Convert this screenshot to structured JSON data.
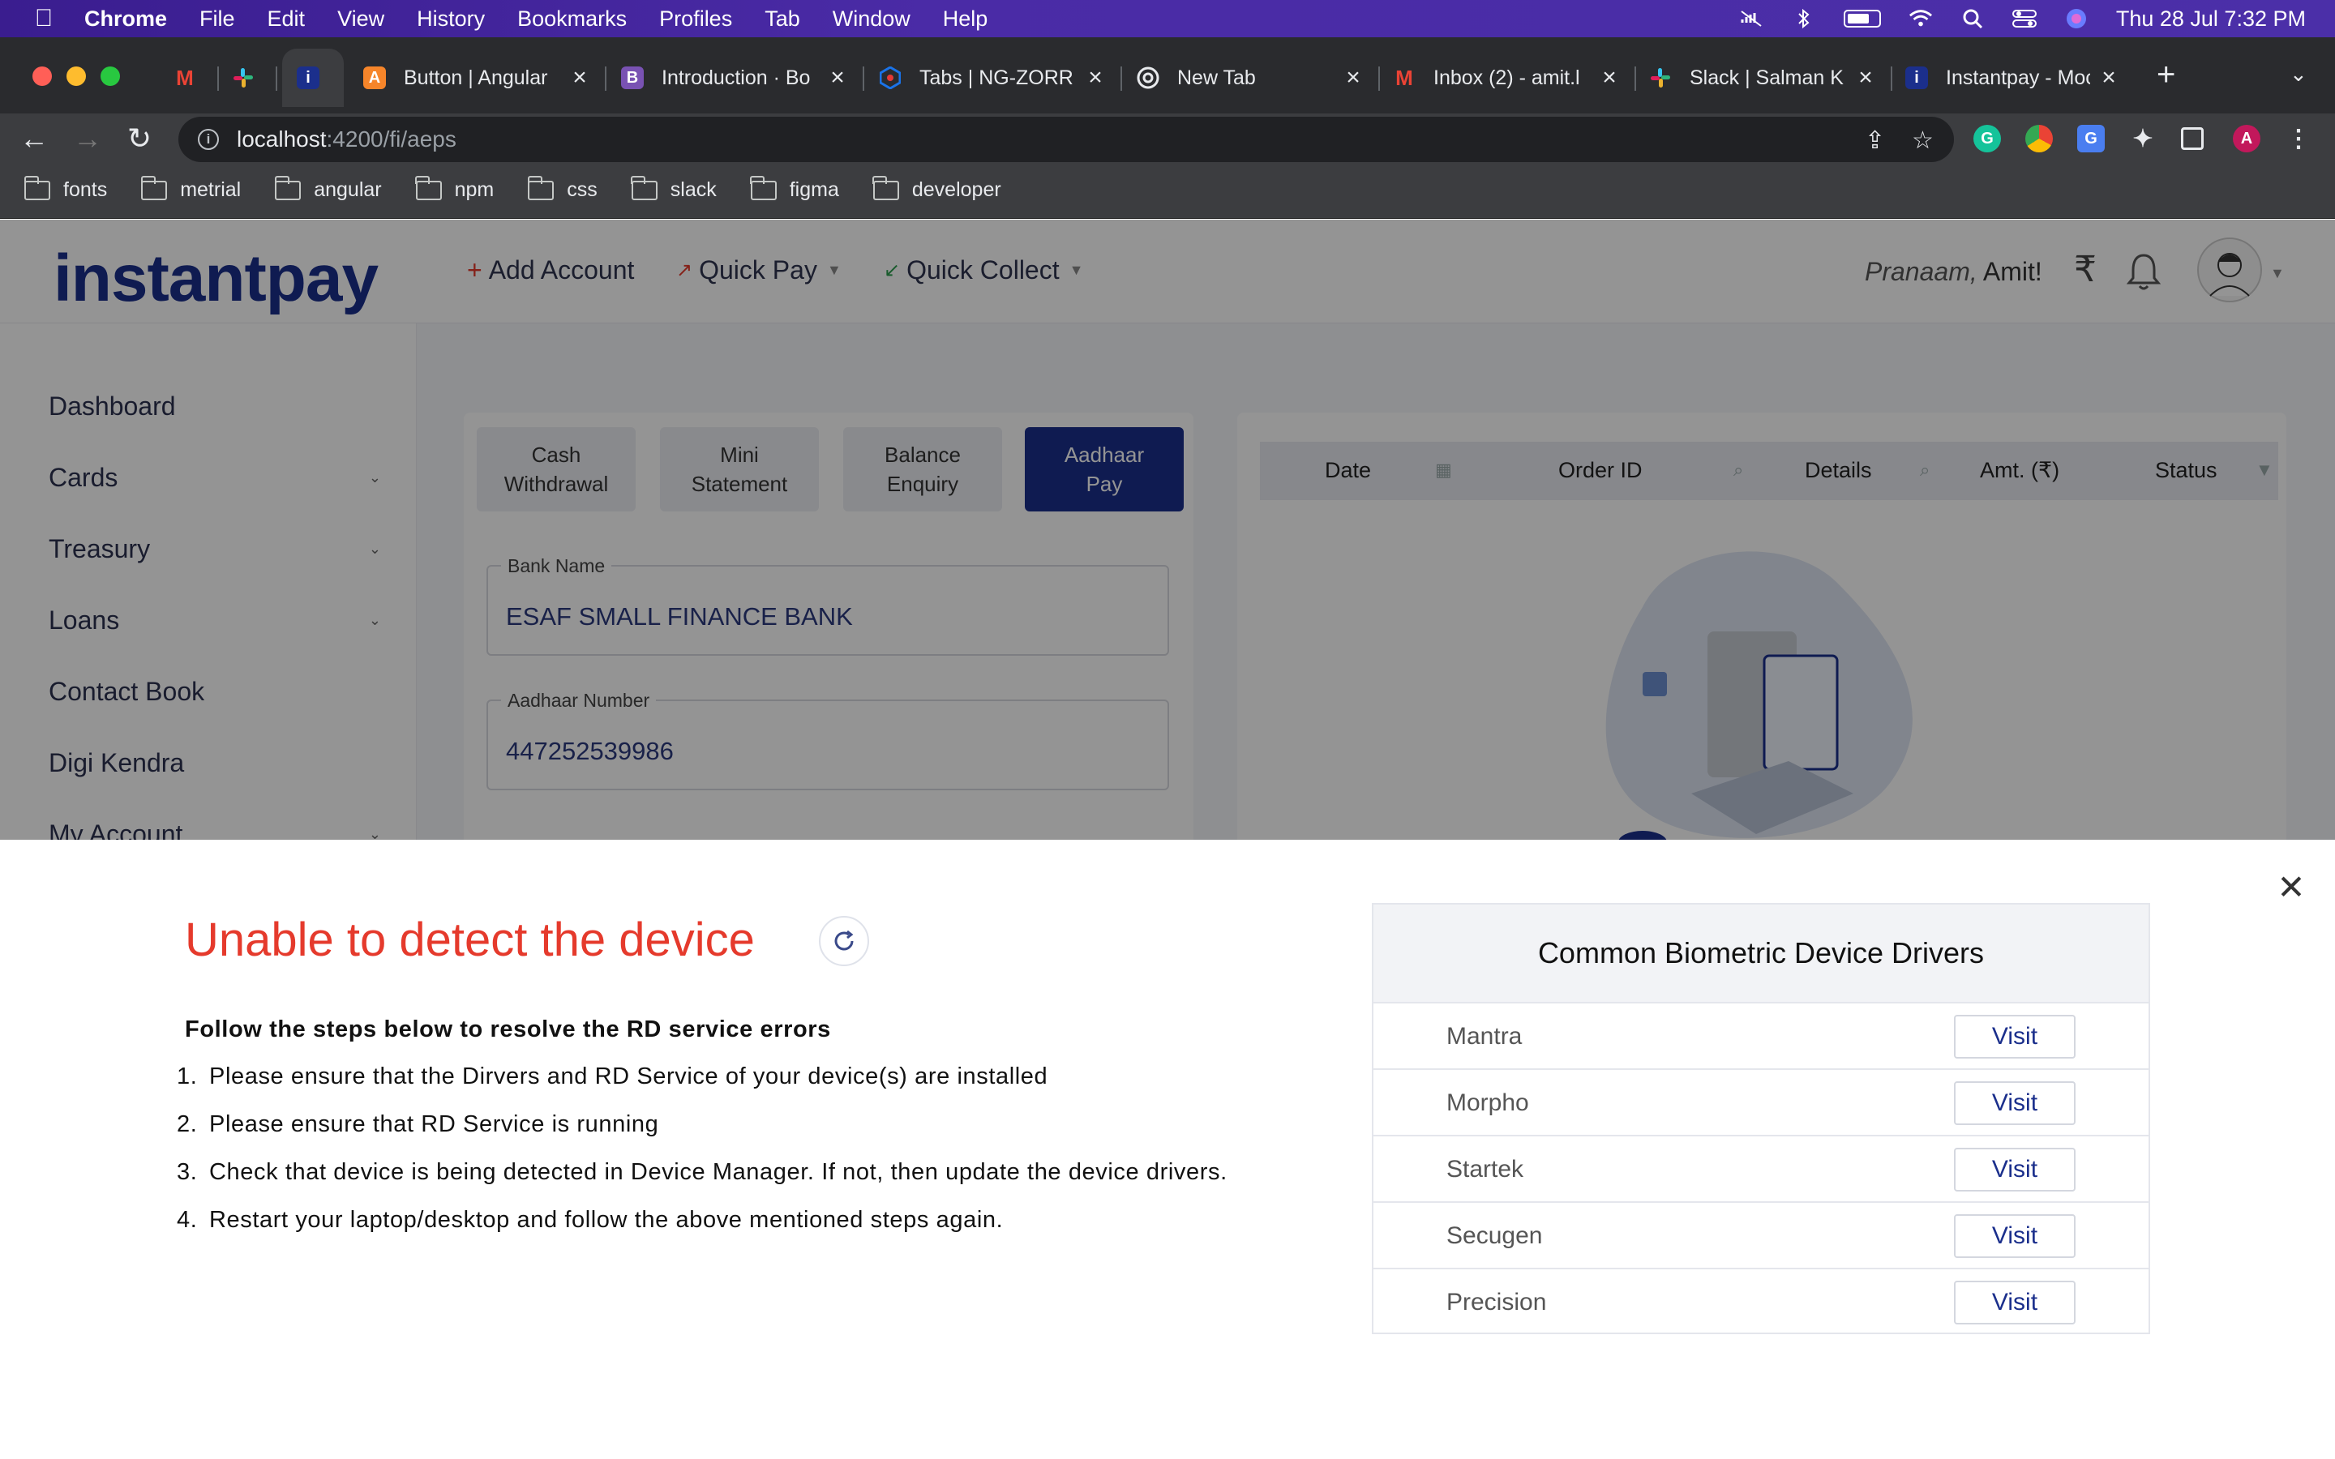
{
  "menubar": {
    "app": "Chrome",
    "items": [
      "File",
      "Edit",
      "View",
      "History",
      "Bookmarks",
      "Profiles",
      "Tab",
      "Window",
      "Help"
    ],
    "clock": "Thu 28 Jul  7:32 PM"
  },
  "tabs": [
    {
      "title": "",
      "icon": "gmail-icon",
      "color": "#ea4335"
    },
    {
      "title": "",
      "icon": "slack-icon",
      "color": "#e01e5a"
    },
    {
      "title": "",
      "icon": "instantpay-icon",
      "color": "#1b2f8c"
    },
    {
      "title": "Button | Angular",
      "icon": "angular-shield-icon",
      "color": "#f6852a"
    },
    {
      "title": "Introduction · Bo",
      "icon": "bootstrap-icon",
      "color": "#7952b3"
    },
    {
      "title": "Tabs | NG-ZORR",
      "icon": "ng-zorro-icon",
      "color": "#1a73e8"
    },
    {
      "title": "New Tab",
      "icon": "chrome-icon",
      "color": "#ffffff"
    },
    {
      "title": "Inbox (2) - amit.l",
      "icon": "gmail-icon",
      "color": "#ea4335"
    },
    {
      "title": "Slack | Salman K",
      "icon": "slack-icon",
      "color": "#e01e5a"
    },
    {
      "title": "Instantpay - Moc",
      "icon": "instantpay-icon",
      "color": "#1b2f8c"
    }
  ],
  "omnibox": {
    "host": "localhost",
    "path": ":4200/fi/aeps"
  },
  "profile_initial": "A",
  "bookmarks": [
    "fonts",
    "metrial",
    "angular",
    "npm",
    "css",
    "slack",
    "figma",
    "developer"
  ],
  "app": {
    "logo": "instantpay",
    "header_links": [
      {
        "prefix": "+",
        "label": "Add Account"
      },
      {
        "prefix": "↗",
        "label": "Quick Pay"
      },
      {
        "prefix": "↙",
        "label": "Quick Collect"
      }
    ],
    "greeting_prefix": "Pranaam,",
    "greeting_name": "Amit!",
    "sidebar": [
      {
        "label": "Dashboard",
        "chevron": false
      },
      {
        "label": "Cards",
        "chevron": true
      },
      {
        "label": "Treasury",
        "chevron": true
      },
      {
        "label": "Loans",
        "chevron": true
      },
      {
        "label": "Contact Book",
        "chevron": false
      },
      {
        "label": "Digi Kendra",
        "chevron": false
      },
      {
        "label": "My Account",
        "chevron": true
      }
    ],
    "service_tabs": [
      "Cash\nWithdrawal",
      "Mini\nStatement",
      "Balance\nEnquiry",
      "Aadhaar\nPay"
    ],
    "active_tab": "Aadhaar\nPay",
    "bank_name_label": "Bank Name",
    "bank_name_value": "ESAF SMALL FINANCE BANK",
    "aadhaar_label": "Aadhaar Number",
    "aadhaar_value": "447252539986",
    "table_headers": [
      "Date",
      "Order ID",
      "Details",
      "Amt. (₹)",
      "Status"
    ]
  },
  "modal": {
    "title": "Unable to detect the device",
    "steps_heading": "Follow the steps below to resolve the RD service errors",
    "steps": [
      "Please ensure that the Dirvers and RD Service of your device(s) are installed",
      "Please ensure that RD Service is running",
      "Check that device is being detected in Device Manager. If not, then update the device drivers.",
      "Restart your laptop/desktop and follow the above mentioned steps again."
    ],
    "drivers_heading": "Common Biometric Device Drivers",
    "drivers": [
      {
        "name": "Mantra",
        "action": "Visit"
      },
      {
        "name": "Morpho",
        "action": "Visit"
      },
      {
        "name": "Startek",
        "action": "Visit"
      },
      {
        "name": "Secugen",
        "action": "Visit"
      },
      {
        "name": "Precision",
        "action": "Visit"
      }
    ]
  }
}
